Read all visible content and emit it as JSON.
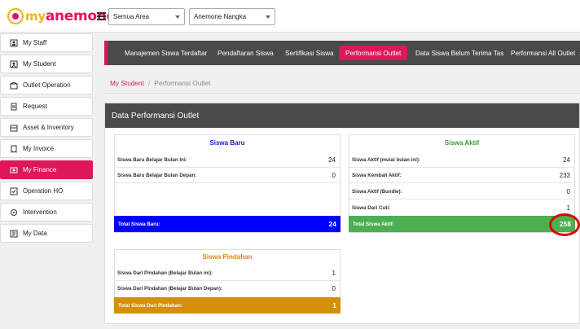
{
  "header": {
    "logo_my": "my",
    "logo_name": "anemone",
    "area_select": "Semua Area",
    "outlet_select": "Anemone Nangka"
  },
  "sidebar": {
    "items": [
      {
        "label": "My Staff",
        "icon": "staff-icon"
      },
      {
        "label": "My Student",
        "icon": "student-icon"
      },
      {
        "label": "Outlet Operation",
        "icon": "outlet-icon"
      },
      {
        "label": "Request",
        "icon": "request-icon"
      },
      {
        "label": "Asset & Inventory",
        "icon": "inventory-icon"
      },
      {
        "label": "My Invoice",
        "icon": "invoice-icon"
      },
      {
        "label": "My Finance",
        "icon": "finance-icon",
        "active": true
      },
      {
        "label": "Operation HO",
        "icon": "operation-icon"
      },
      {
        "label": "Intervention",
        "icon": "intervention-icon"
      },
      {
        "label": "My Data",
        "icon": "data-icon"
      }
    ],
    "active_color": "#dc1858"
  },
  "tabs": [
    {
      "label": "Manajemen Siswa Terdaftar"
    },
    {
      "label": "Pendaftaran Siswa"
    },
    {
      "label": "Sertifikasi Siswa"
    },
    {
      "label": "Performansi Outlet",
      "active": true
    },
    {
      "label": "Data Siswa Belum Terima Tas"
    },
    {
      "label": "Performansi All Outlet",
      "chevron": "»"
    }
  ],
  "breadcrumb": {
    "parent": "My Student",
    "separator": "/",
    "current": "Performansi Outlet"
  },
  "panel": {
    "title": "Data Performansi Outlet",
    "siswa_baru": {
      "title": "Siswa Baru",
      "color": "#1a1ad0",
      "rows": [
        {
          "label": "Siswa Baru Belajar Bulan Ini:",
          "value": "24"
        },
        {
          "label": "Siswa Baru Belajar Bulan Depan:",
          "value": "0"
        }
      ],
      "total_label": "Total Siswa Baru:",
      "total_value": "24",
      "total_color": "#0000ff"
    },
    "siswa_aktif": {
      "title": "Siswa Aktif",
      "color": "#3a9a3a",
      "rows": [
        {
          "label": "Siswa Aktif (mulai bulan ini):",
          "value": "24"
        },
        {
          "label": "Siswa Kembali Aktif:",
          "value": "233"
        },
        {
          "label": "Siswa Aktif (Bundle):",
          "value": "0"
        },
        {
          "label": "Siswa Dari Cuti:",
          "value": "1"
        }
      ],
      "total_label": "Total Siswa Aktif:",
      "total_value": "258",
      "total_color": "#4caf50"
    },
    "siswa_pindahan": {
      "title": "Siswa Pindahan",
      "color": "#d4880a",
      "rows": [
        {
          "label": "Siswa Dari Pindahan (Belajar Bulan ini):",
          "value": "1"
        },
        {
          "label": "Siswa Dari Pindahan (Belajar Bulan Depan):",
          "value": "0"
        }
      ],
      "total_label": "Total Siswa Dari Pindahan:",
      "total_value": "1",
      "total_color": "#d4900a"
    }
  },
  "annotation": {
    "ring_color": "#e00000"
  }
}
